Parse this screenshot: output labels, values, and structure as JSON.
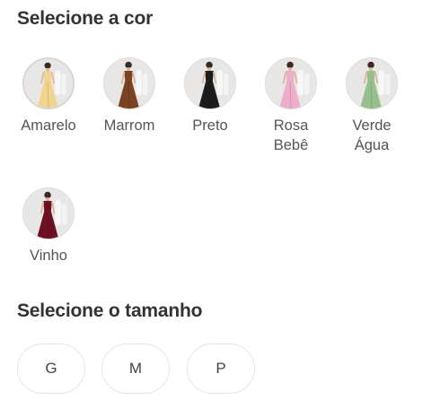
{
  "color_section": {
    "heading": "Selecione a cor",
    "selected": "Amarelo",
    "options": [
      {
        "label": "Amarelo",
        "color": "#f2d38f",
        "icon": "yellow-dress-thumbnail"
      },
      {
        "label": "Marrom",
        "color": "#7a4422",
        "icon": "brown-dress-thumbnail"
      },
      {
        "label": "Preto",
        "color": "#1c1c1c",
        "icon": "black-dress-thumbnail"
      },
      {
        "label": "Rosa\nBebê",
        "color": "#eeaecb",
        "icon": "pink-dress-thumbnail"
      },
      {
        "label": "Verde\nÁgua",
        "color": "#97bf8e",
        "icon": "green-dress-thumbnail"
      },
      {
        "label": "Vinho",
        "color": "#6e1024",
        "icon": "wine-dress-thumbnail"
      }
    ]
  },
  "size_section": {
    "heading": "Selecione o tamanho",
    "options": [
      "G",
      "M",
      "P"
    ]
  }
}
